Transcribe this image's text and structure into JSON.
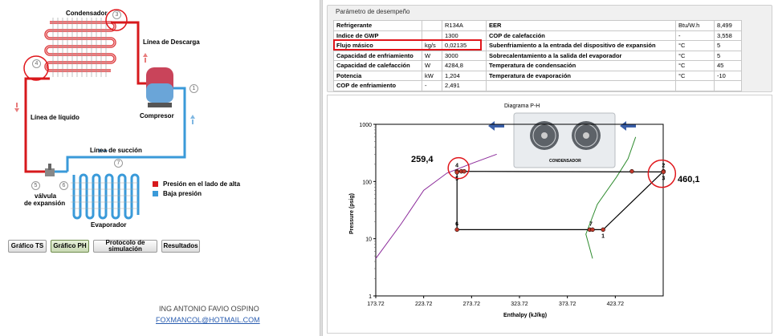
{
  "left": {
    "labels": {
      "condensador": "Condensador",
      "linea_descarga": "Línea de Descarga",
      "compresor": "Compresor",
      "linea_liquido": "Línea de líquido",
      "linea_succion": "Línea de succión",
      "valvula": "válvula",
      "expansion": "de expansión",
      "evaporador": "Evaporador"
    },
    "points": [
      "1",
      "2",
      "3",
      "4",
      "5",
      "6",
      "7"
    ],
    "legend": {
      "alta": "Presión en el lado de alta",
      "baja": "Baja presión",
      "alta_color": "#d7191c",
      "baja_color": "#3a9ad9"
    },
    "buttons": {
      "ts": "Gráfico TS",
      "ph": "Gráfico PH",
      "protocolo_1": "Protocolo de",
      "protocolo_2": "simulación",
      "resultados": "Resultados"
    },
    "author": "ING ANTONIO FAVIO OSPINO",
    "email": "FOXMANCOL@HOTMAIL.COM"
  },
  "performance": {
    "title": "Parámetro de desempeño",
    "rows": [
      [
        "Refrigerante",
        "",
        "R134A",
        "EER",
        "Btu/W.h",
        "8,499"
      ],
      [
        "Indice de GWP",
        "",
        "1300",
        "COP de calefacción",
        "-",
        "3,558"
      ],
      [
        "Flujo másico",
        "kg/s",
        "0,02135",
        "Subenfriamiento a la entrada del dispositivo de expansión",
        "°C",
        "5"
      ],
      [
        "Capacidad de enfriamiento",
        "W",
        "3000",
        "Sobrecalentamiento a la salida del evaporador",
        "°C",
        "5"
      ],
      [
        "Capacidad de calefacción",
        "W",
        "4284,8",
        "Temperatura de condensación",
        "°C",
        "45"
      ],
      [
        "Potencia",
        "kW",
        "1,204",
        "Temperatura de evaporación",
        "°C",
        "-10"
      ],
      [
        "COP de enfriamiento",
        "-",
        "2,491",
        "",
        "",
        ""
      ]
    ]
  },
  "chart_data": {
    "type": "line",
    "title": "Diagrama P-H",
    "xlabel": "Enthalpy (kJ/kg)",
    "ylabel": "Pressure (psig)",
    "xlim": [
      173.72,
      473.72
    ],
    "ylim": [
      1,
      1000
    ],
    "y_scale": "log",
    "x_ticks": [
      "173.72",
      "223.72",
      "273.72",
      "323.72",
      "373.72",
      "423.72"
    ],
    "y_ticks": [
      "1",
      "10",
      "100",
      "1000"
    ],
    "series": [
      {
        "color": "#8b2a9a",
        "points": [
          [
            173.72,
            4.5
          ],
          [
            200,
            18
          ],
          [
            223.72,
            70
          ],
          [
            248,
            140
          ],
          [
            275,
            210
          ],
          [
            300,
            300
          ]
        ]
      },
      {
        "color": "#2e8b2e",
        "points": [
          [
            400,
            4.5
          ],
          [
            393,
            12
          ],
          [
            405,
            40
          ],
          [
            425,
            120
          ],
          [
            437,
            250
          ],
          [
            445,
            600
          ]
        ]
      },
      {
        "color": "#000000",
        "points": [
          [
            411,
            14.4
          ],
          [
            474,
            150.5
          ],
          [
            474,
            147
          ],
          [
            258.5,
            150.5
          ],
          [
            258.5,
            14.4
          ],
          [
            411,
            14.4
          ]
        ]
      }
    ],
    "state_points": [
      {
        "label": "1",
        "x": 411,
        "y": 14.4
      },
      {
        "label": "2",
        "x": 474,
        "y": 150.5
      },
      {
        "label": "3",
        "x": 474,
        "y": 147
      },
      {
        "label": "4",
        "x": 258.5,
        "y": 150.5
      },
      {
        "label": "5",
        "x": 258.5,
        "y": 145
      },
      {
        "label": "6",
        "x": 258.5,
        "y": 14.4
      },
      {
        "label": "7",
        "x": 400,
        "y": 14.4
      }
    ],
    "extra_markers": [
      {
        "x": 263,
        "y": 150.5
      },
      {
        "x": 266,
        "y": 150.5
      },
      {
        "x": 441,
        "y": 150.5
      },
      {
        "x": 397,
        "y": 14.4
      }
    ],
    "annotations": {
      "p_high": "259,4",
      "h_out": "460,1",
      "unit_label": "CONDENSADOR"
    }
  }
}
